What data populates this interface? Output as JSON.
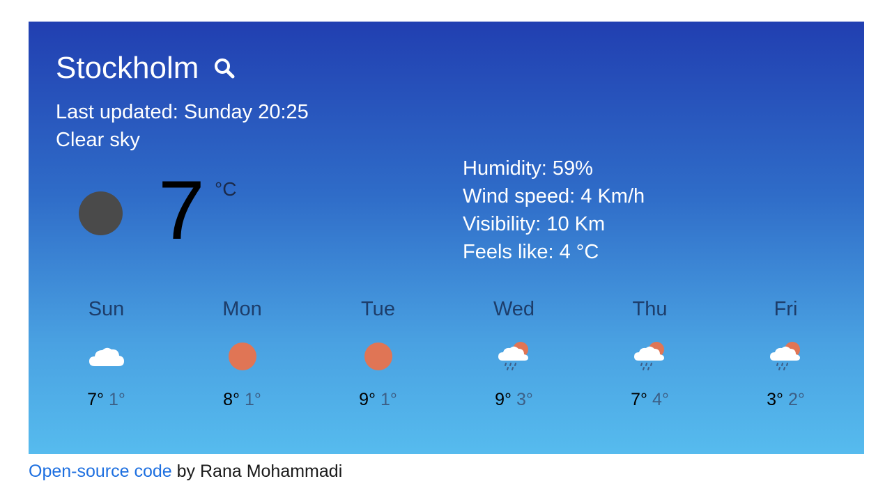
{
  "city": "Stockholm",
  "last_updated_label": "Last updated:",
  "last_updated_value": "Sunday 20:25",
  "description": "Clear sky",
  "current": {
    "temperature": "7",
    "unit": "°C",
    "icon": "clear-night-icon"
  },
  "details": {
    "humidity": "Humidity: 59%",
    "wind": "Wind speed: 4 Km/h",
    "visibility": "Visibility: 10 Km",
    "feels_like": "Feels like: 4 °C"
  },
  "forecast": [
    {
      "day": "Sun",
      "icon": "cloud-icon",
      "max": "7°",
      "min": "1°"
    },
    {
      "day": "Mon",
      "icon": "sun-icon",
      "max": "8°",
      "min": "1°"
    },
    {
      "day": "Tue",
      "icon": "sun-icon",
      "max": "9°",
      "min": "1°"
    },
    {
      "day": "Wed",
      "icon": "sun-cloud-rain-icon",
      "max": "9°",
      "min": "3°"
    },
    {
      "day": "Thu",
      "icon": "sun-cloud-rain-icon",
      "max": "7°",
      "min": "4°"
    },
    {
      "day": "Fri",
      "icon": "sun-cloud-rain-icon",
      "max": "3°",
      "min": "2°"
    }
  ],
  "footer": {
    "link_text": "Open-source code",
    "author_text": " by Rana Mohammadi"
  },
  "colors": {
    "gradient_top": "#213fb1",
    "gradient_bottom": "#56bbee",
    "sun": "#e07555",
    "link": "#1d6fe0"
  }
}
